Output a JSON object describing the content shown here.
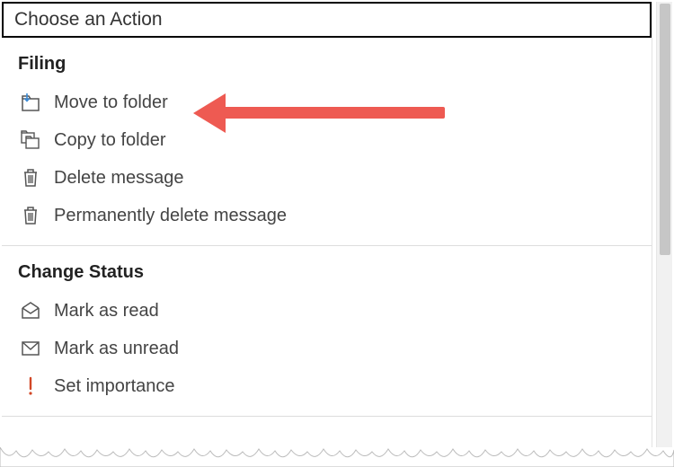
{
  "header": {
    "title": "Choose an Action"
  },
  "sections": [
    {
      "title": "Filing",
      "items": [
        {
          "label": "Move to folder",
          "icon": "folder-move-in-icon"
        },
        {
          "label": "Copy to folder",
          "icon": "folder-copy-icon"
        },
        {
          "label": "Delete message",
          "icon": "trash-icon"
        },
        {
          "label": "Permanently delete message",
          "icon": "trash-icon"
        }
      ]
    },
    {
      "title": "Change Status",
      "items": [
        {
          "label": "Mark as read",
          "icon": "envelope-open-icon"
        },
        {
          "label": "Mark as unread",
          "icon": "envelope-closed-icon"
        },
        {
          "label": "Set importance",
          "icon": "importance-icon"
        }
      ]
    }
  ],
  "annotation": {
    "target": "Move to folder",
    "color": "#ee5a52"
  }
}
